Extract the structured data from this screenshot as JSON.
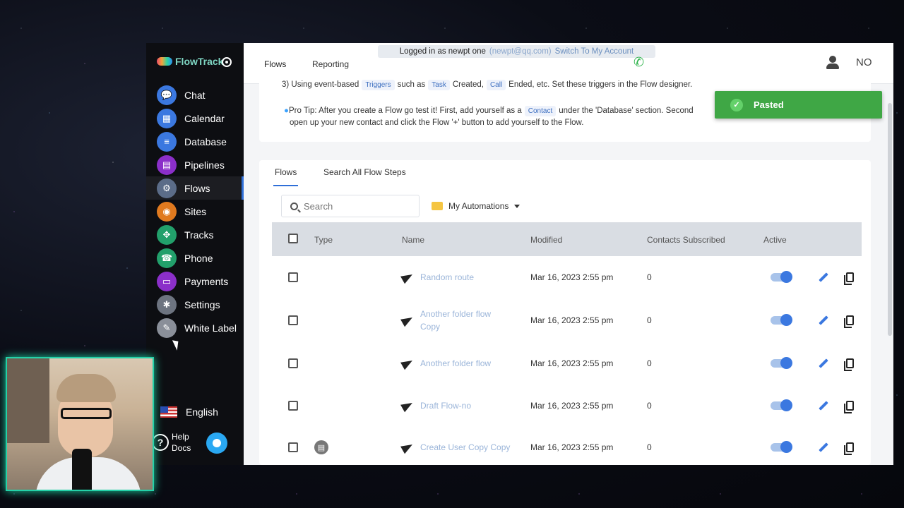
{
  "brand": {
    "name": "FlowTrack"
  },
  "nav": [
    {
      "label": "Chat",
      "icon": "chat-icon",
      "color": "#3b78e0"
    },
    {
      "label": "Calendar",
      "icon": "calendar-icon",
      "color": "#3b78e0"
    },
    {
      "label": "Database",
      "icon": "database-icon",
      "color": "#3b78e0"
    },
    {
      "label": "Pipelines",
      "icon": "pipelines-icon",
      "color": "#8b2fc9"
    },
    {
      "label": "Flows",
      "icon": "gear-icon",
      "color": "#5b6c88"
    },
    {
      "label": "Sites",
      "icon": "sites-icon",
      "color": "#e07a1f"
    },
    {
      "label": "Tracks",
      "icon": "tracks-icon",
      "color": "#22a06b"
    },
    {
      "label": "Phone",
      "icon": "phone-icon",
      "color": "#22a06b"
    },
    {
      "label": "Payments",
      "icon": "payments-icon",
      "color": "#8b2fc9"
    },
    {
      "label": "Settings",
      "icon": "settings-icon",
      "color": "#6d7480"
    },
    {
      "label": "White Label",
      "icon": "white-label-icon",
      "color": "#8a8f99"
    }
  ],
  "language": "English",
  "help": {
    "label": "Help Docs"
  },
  "topbar": {
    "tabs": [
      "Flows",
      "Reporting"
    ],
    "banner": {
      "text": "Logged in as newpt one",
      "email": "(newpt@qq.com)",
      "switch": "Switch To My Account"
    },
    "initials": "NO"
  },
  "tips": {
    "line1": {
      "prefix": "3) Using event-based",
      "chip1": "Triggers",
      "mid1": "such as",
      "chip2": "Task",
      "mid2": "Created,",
      "chip3": "Call",
      "suffix": "Ended, etc. Set these triggers in the Flow designer."
    },
    "line2": {
      "prefix": "Pro Tip: After you create a Flow go test it! First, add yourself as a",
      "chip": "Contact",
      "suffix": "under the 'Database' section. Second"
    },
    "line3": "open up your new contact and click the Flow '+' button to add yourself to the Flow."
  },
  "card": {
    "tabs": [
      "Flows",
      "Search All Flow Steps"
    ],
    "search_placeholder": "Search",
    "folder": "My Automations",
    "columns": [
      "Type",
      "Name",
      "Modified",
      "Contacts Subscribed",
      "Active"
    ],
    "rows": [
      {
        "name": "Random route",
        "modified": "Mar 16, 2023 2:55 pm",
        "contacts": "0",
        "active": true
      },
      {
        "name": "Another folder flow Copy",
        "modified": "Mar 16, 2023 2:55 pm",
        "contacts": "0",
        "active": true
      },
      {
        "name": "Another folder flow",
        "modified": "Mar 16, 2023 2:55 pm",
        "contacts": "0",
        "active": true
      },
      {
        "name": "Draft Flow-no",
        "modified": "Mar 16, 2023 2:55 pm",
        "contacts": "0",
        "active": true
      },
      {
        "name": "Create User Copy Copy",
        "modified": "Mar 16, 2023 2:55 pm",
        "contacts": "0",
        "active": true
      }
    ]
  },
  "toast": {
    "text": "Pasted",
    "color": "#3fa745"
  }
}
